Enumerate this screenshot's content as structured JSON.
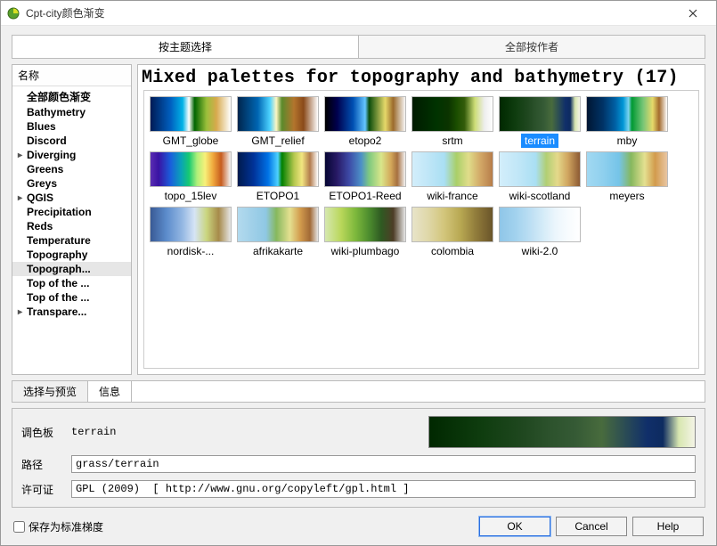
{
  "window": {
    "title": "Cpt-city颜色渐变"
  },
  "top_tabs": {
    "by_topic": "按主题选择",
    "by_author": "全部按作者"
  },
  "tree": {
    "header": "名称",
    "items": [
      {
        "label": "全部颜色渐变",
        "expandable": false
      },
      {
        "label": "Bathymetry",
        "expandable": false
      },
      {
        "label": "Blues",
        "expandable": false
      },
      {
        "label": "Discord",
        "expandable": false
      },
      {
        "label": "Diverging",
        "expandable": true
      },
      {
        "label": "Greens",
        "expandable": false
      },
      {
        "label": "Greys",
        "expandable": false
      },
      {
        "label": "QGIS",
        "expandable": true
      },
      {
        "label": "Precipitation",
        "expandable": false
      },
      {
        "label": "Reds",
        "expandable": false
      },
      {
        "label": "Temperature",
        "expandable": false
      },
      {
        "label": "Topography",
        "expandable": false
      },
      {
        "label": "Topograph...",
        "expandable": false,
        "selected": true
      },
      {
        "label": "Top of the ...",
        "expandable": false
      },
      {
        "label": "Top of the ...",
        "expandable": false
      },
      {
        "label": "Transpare...",
        "expandable": true
      }
    ]
  },
  "gallery": {
    "title": "Mixed palettes for topography and bathymetry (17)",
    "items": [
      {
        "label": "GMT_globe",
        "g": "g-globe"
      },
      {
        "label": "GMT_relief",
        "g": "g-relief"
      },
      {
        "label": "etopo2",
        "g": "g-etopo2"
      },
      {
        "label": "srtm",
        "g": "g-srtm"
      },
      {
        "label": "terrain",
        "g": "g-terrain",
        "selected": true
      },
      {
        "label": "mby",
        "g": "g-mby"
      },
      {
        "label": "topo_15lev",
        "g": "g-topo15"
      },
      {
        "label": "ETOPO1",
        "g": "g-etopo1"
      },
      {
        "label": "ETOPO1-Reed",
        "g": "g-etopo1r"
      },
      {
        "label": "wiki-france",
        "g": "g-wikif"
      },
      {
        "label": "wiki-scotland",
        "g": "g-wikis"
      },
      {
        "label": "meyers",
        "g": "g-meyers"
      },
      {
        "label": "nordisk-...",
        "g": "g-nordisk"
      },
      {
        "label": "afrikakarte",
        "g": "g-afrik"
      },
      {
        "label": "wiki-plumbago",
        "g": "g-plumb"
      },
      {
        "label": "colombia",
        "g": "g-colombia"
      },
      {
        "label": "wiki-2.0",
        "g": "g-wiki20"
      }
    ]
  },
  "preview_tabs": {
    "select": "选择与预览",
    "info": "信息"
  },
  "preview": {
    "palette_lbl": "调色板",
    "palette_val": "terrain",
    "path_lbl": "路径",
    "path_val": "grass/terrain",
    "license_lbl": "许可证",
    "license_val": "GPL (2009)  [ http://www.gnu.org/copyleft/gpl.html ]"
  },
  "footer": {
    "save_std": "保存为标准梯度",
    "ok": "OK",
    "cancel": "Cancel",
    "help": "Help"
  }
}
